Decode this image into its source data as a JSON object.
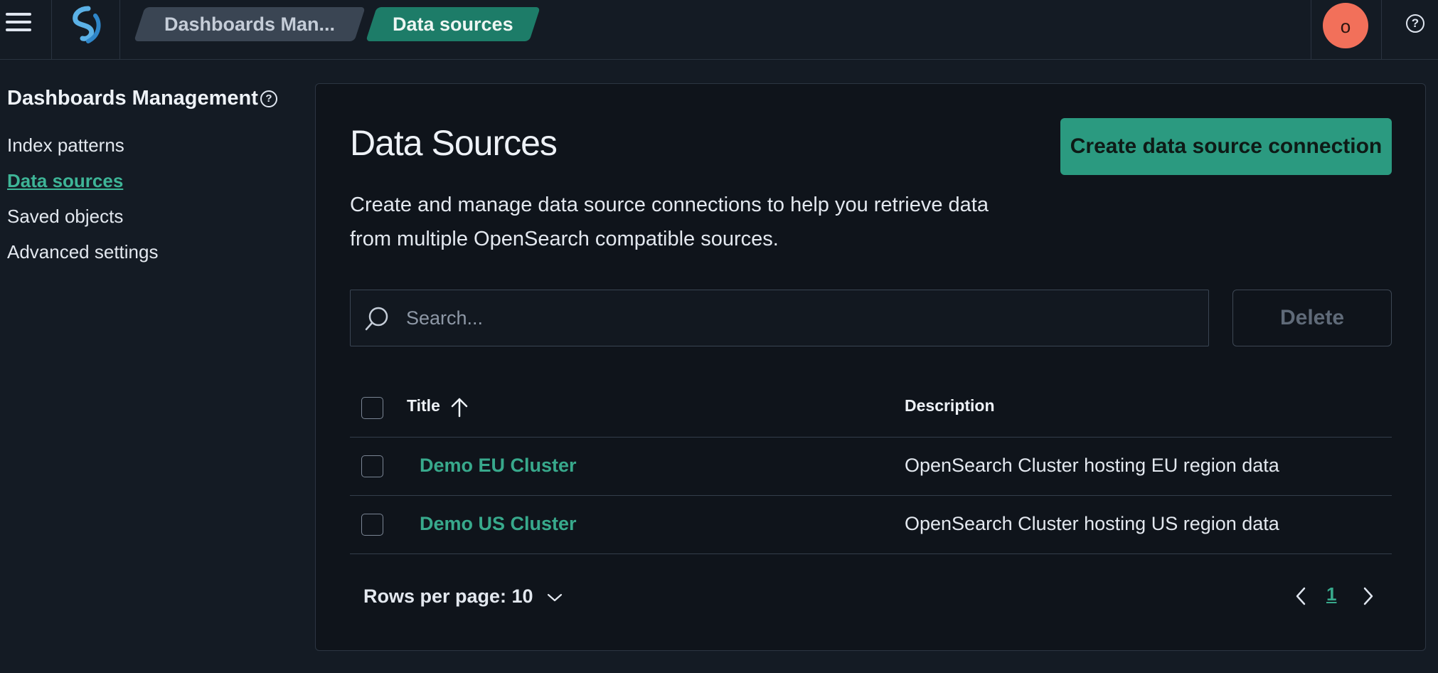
{
  "header": {
    "breadcrumbs": [
      "Dashboards Man...",
      "Data sources"
    ],
    "avatar_initial": "o",
    "help_glyph": "?"
  },
  "sidebar": {
    "title": "Dashboards Management",
    "help_glyph": "?",
    "items": [
      {
        "label": "Index patterns",
        "active": false
      },
      {
        "label": "Data sources",
        "active": true
      },
      {
        "label": "Saved objects",
        "active": false
      },
      {
        "label": "Advanced settings",
        "active": false
      }
    ]
  },
  "main": {
    "title": "Data Sources",
    "create_button": "Create data source connection",
    "description": "Create and manage data source connections to help you retrieve data from multiple OpenSearch compatible sources.",
    "search_placeholder": "Search...",
    "delete_button": "Delete",
    "table": {
      "columns": [
        "Title",
        "Description"
      ],
      "rows": [
        {
          "title": "Demo EU Cluster",
          "description": "OpenSearch Cluster hosting EU region data"
        },
        {
          "title": "Demo US Cluster",
          "description": "OpenSearch Cluster hosting US region data"
        }
      ]
    },
    "rows_per_page": "Rows per page: 10",
    "current_page": "1"
  },
  "colors": {
    "accent": "#2b9a80",
    "link": "#38a98c",
    "avatar": "#f2705a",
    "background": "#141b24",
    "panel": "#0f141b"
  },
  "icons": [
    "menu-icon",
    "opensearch-logo-icon",
    "help-icon",
    "search-icon",
    "sort-ascending-icon",
    "chevron-down-icon",
    "chevron-left-icon",
    "chevron-right-icon"
  ]
}
